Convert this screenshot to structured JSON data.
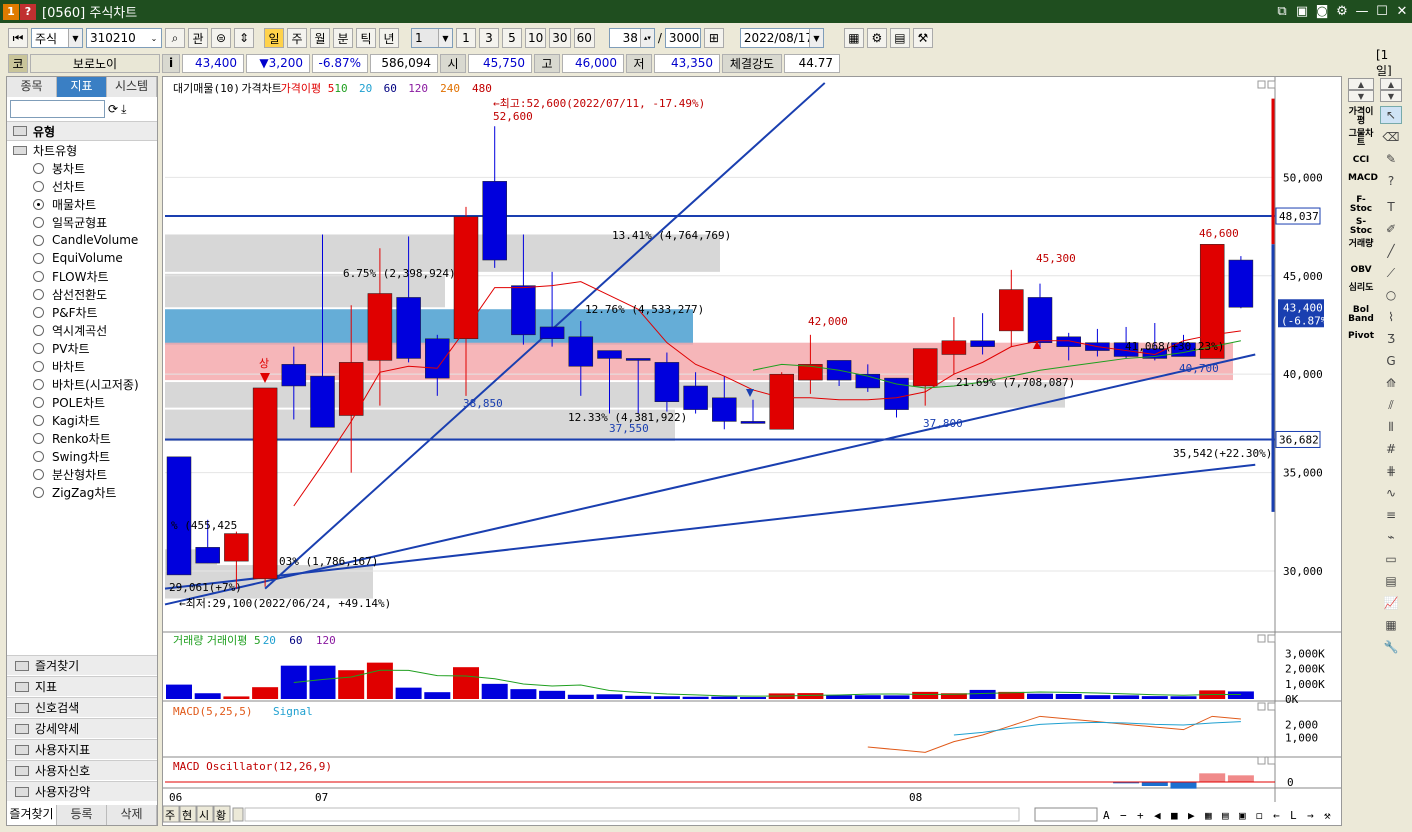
{
  "window": {
    "app_icon_1": "1",
    "app_icon_2": "?",
    "title": "[0560] 주식차트"
  },
  "toolbar": {
    "market": "주식",
    "code": "310210",
    "gwan": "관",
    "period_buttons": [
      "일",
      "주",
      "월",
      "분",
      "틱",
      "년"
    ],
    "active_period": "일",
    "interval_value": "1",
    "quick_counts": [
      "1",
      "3",
      "5",
      "10",
      "30",
      "60"
    ],
    "count_value": "38",
    "slash": "/",
    "total_count": "3000",
    "date_value": "2022/08/17"
  },
  "quote": {
    "code_badge": "코",
    "name": "보로노이",
    "info_btn": "i",
    "price": "43,400",
    "change": "▼3,200",
    "change_pct": "-6.87%",
    "volume": "586,094",
    "open_label": "시",
    "open": "45,750",
    "high_label": "고",
    "high": "46,000",
    "low_label": "저",
    "low": "43,350",
    "strength_label": "체결강도",
    "strength": "44.77",
    "period_badge": "[1일]"
  },
  "left_panel": {
    "tabs": [
      "종목",
      "지표",
      "시스템"
    ],
    "active_tab": "지표",
    "section_title": "유형",
    "subsection": "차트유형",
    "chart_types": [
      "봉차트",
      "선차트",
      "매물차트",
      "일목균형표",
      "CandleVolume",
      "EquiVolume",
      "FLOW차트",
      "삼선전환도",
      "P&F차트",
      "역시계곡선",
      "PV차트",
      "바차트",
      "바차트(시고저종)",
      "POLE차트",
      "Kagi차트",
      "Renko차트",
      "Swing차트",
      "분산형차트",
      "ZigZag차트"
    ],
    "selected_type": "매물차트",
    "folders": [
      "즐겨찾기",
      "지표",
      "신호검색",
      "강세약세",
      "사용자지표",
      "사용자신호",
      "사용자강약"
    ],
    "bottom_tabs": [
      "즐겨찾기",
      "등록",
      "삭제"
    ]
  },
  "chart": {
    "main_legend": [
      "대기매물(10)",
      "가격차트",
      "가격이평 5",
      "10",
      "20",
      "60",
      "120",
      "240",
      "480"
    ],
    "volume_legend": [
      "거래량",
      "거래이평 5",
      "20",
      "60",
      "120"
    ],
    "macd_legend": [
      "MACD(5,25,5)",
      "Signal"
    ],
    "osc_legend": [
      "MACD Oscillator(12,26,9)"
    ],
    "bottom_tabs": [
      "주",
      "현",
      "시",
      "황"
    ],
    "x_labels": [
      "06",
      "07",
      "08"
    ],
    "annotations": {
      "high_note": "←최고:52,600(2022/07/11, -17.49%)",
      "low_note": "←최저:29,100(2022/06/24, +49.14%)",
      "hi_52600": "52,600",
      "lo_38850": "38,850",
      "lo_37550": "37,550",
      "v_42000": "42,000",
      "lo_37800": "37,800",
      "v_45300": "45,300",
      "v_46600": "46,600",
      "lo_40700": "40,700",
      "sang": "상",
      "pct_a": "13.41% (4,764,769)",
      "pct_b": "6.75% (2,398,924)",
      "pct_c": "12.76% (4,533,277)",
      "pct_d": "12.33% (4,381,922)",
      "pct_e": "21.69% (7,708,087)",
      "pct_f": "% (455,425",
      "pct_g": "03% (1,786,167)",
      "fib_1": "35,542(+22.30%)",
      "fib_2": "41,068(+30.23%)",
      "fib_3": "29,061(+7%)"
    },
    "price_axis": [
      "50,000",
      "45,000",
      "40,000",
      "35,000",
      "30,000"
    ],
    "price_tags": [
      "48,037",
      "36,682"
    ],
    "current_tag": [
      "43,400",
      "(-6.87%)"
    ],
    "volume_axis": [
      "3,000K",
      "2,000K",
      "1,000K",
      "0K"
    ],
    "macd_axis": [
      "2,000",
      "1,000"
    ],
    "osc_axis": [
      "0"
    ],
    "colors": {
      "up": "#e00000",
      "down": "#0000dd",
      "band_red": "#f4a9ad",
      "band_blue": "#4a9fd0",
      "band_gray": "#d0d0d0",
      "trend": "#1a3fb0"
    }
  },
  "right_tools": {
    "labels": [
      "가격이평",
      "그물차트",
      "CCI",
      "MACD",
      "F-Stoc",
      "S-Stoc",
      "거래량",
      "OBV",
      "심리도",
      "Bol Band",
      "Pivot"
    ]
  },
  "chart_data": {
    "type": "candlestick",
    "y_range": [
      27000,
      55000
    ],
    "candles": [
      {
        "o": 35800,
        "h": 35800,
        "l": 29800,
        "c": 29800
      },
      {
        "o": 31200,
        "h": 32600,
        "l": 30400,
        "c": 30400
      },
      {
        "o": 30500,
        "h": 32000,
        "l": 29100,
        "c": 31900
      },
      {
        "o": 29600,
        "h": 39300,
        "l": 29200,
        "c": 39300
      },
      {
        "o": 40500,
        "h": 41400,
        "l": 37700,
        "c": 39400
      },
      {
        "o": 39900,
        "h": 47100,
        "l": 37300,
        "c": 37300
      },
      {
        "o": 37900,
        "h": 43500,
        "l": 35000,
        "c": 40600
      },
      {
        "o": 40700,
        "h": 46400,
        "l": 38400,
        "c": 44100
      },
      {
        "o": 43900,
        "h": 47000,
        "l": 40600,
        "c": 40800
      },
      {
        "o": 41800,
        "h": 42000,
        "l": 38900,
        "c": 39800
      },
      {
        "o": 41800,
        "h": 48500,
        "l": 38900,
        "c": 48000
      },
      {
        "o": 49800,
        "h": 52600,
        "l": 45400,
        "c": 45800
      },
      {
        "o": 44500,
        "h": 47100,
        "l": 41500,
        "c": 42000
      },
      {
        "o": 42400,
        "h": 45200,
        "l": 41400,
        "c": 41800
      },
      {
        "o": 41900,
        "h": 42700,
        "l": 38900,
        "c": 40400
      },
      {
        "o": 41200,
        "h": 41200,
        "l": 38000,
        "c": 40800
      },
      {
        "o": 40800,
        "h": 40800,
        "l": 38000,
        "c": 40700
      },
      {
        "o": 40600,
        "h": 41100,
        "l": 38100,
        "c": 38600
      },
      {
        "o": 39400,
        "h": 40100,
        "l": 38000,
        "c": 38200
      },
      {
        "o": 38800,
        "h": 39900,
        "l": 37200,
        "c": 37600
      },
      {
        "o": 37600,
        "h": 38700,
        "l": 37500,
        "c": 37500
      },
      {
        "o": 37200,
        "h": 40100,
        "l": 37200,
        "c": 40000
      },
      {
        "o": 39700,
        "h": 42000,
        "l": 39000,
        "c": 40500
      },
      {
        "o": 40700,
        "h": 40700,
        "l": 39400,
        "c": 39700
      },
      {
        "o": 40000,
        "h": 40500,
        "l": 39100,
        "c": 39300
      },
      {
        "o": 39800,
        "h": 39800,
        "l": 37800,
        "c": 38200
      },
      {
        "o": 39400,
        "h": 41300,
        "l": 38400,
        "c": 41300
      },
      {
        "o": 41000,
        "h": 42900,
        "l": 40000,
        "c": 41700
      },
      {
        "o": 41700,
        "h": 43100,
        "l": 41000,
        "c": 41400
      },
      {
        "o": 42200,
        "h": 45300,
        "l": 41400,
        "c": 44300
      },
      {
        "o": 43900,
        "h": 44600,
        "l": 41300,
        "c": 41600
      },
      {
        "o": 41900,
        "h": 42100,
        "l": 40700,
        "c": 41400
      },
      {
        "o": 41600,
        "h": 42300,
        "l": 40900,
        "c": 41200
      },
      {
        "o": 41600,
        "h": 42400,
        "l": 40800,
        "c": 40900
      },
      {
        "o": 41300,
        "h": 42600,
        "l": 40700,
        "c": 40800
      },
      {
        "o": 41600,
        "h": 42000,
        "l": 40900,
        "c": 40900
      },
      {
        "o": 40800,
        "h": 46600,
        "l": 40800,
        "c": 46600
      },
      {
        "o": 45800,
        "h": 46000,
        "l": 43350,
        "c": 43400
      }
    ],
    "ma5": [
      null,
      null,
      null,
      null,
      33300,
      35400,
      37600,
      40100,
      40400,
      40300,
      42300,
      44400,
      44400,
      44500,
      44700,
      44000,
      43300,
      41600,
      40500,
      39900,
      39200,
      38800,
      38800,
      38700,
      38700,
      38800,
      39100,
      40000,
      40600,
      41400,
      41700,
      41700,
      41400,
      41200,
      41000,
      41700,
      42000,
      42200
    ],
    "ma20": [
      null,
      null,
      null,
      null,
      null,
      null,
      null,
      null,
      null,
      null,
      null,
      null,
      null,
      null,
      null,
      null,
      null,
      null,
      null,
      null,
      40200,
      40500,
      40400,
      40200,
      39900,
      39500,
      39300,
      39400,
      39600,
      39900,
      40200,
      40400,
      40600,
      40800,
      40900,
      41100,
      41400,
      41700
    ],
    "volume_k": [
      950,
      380,
      170,
      780,
      2200,
      2200,
      1900,
      2400,
      750,
      450,
      2100,
      1000,
      650,
      540,
      280,
      310,
      210,
      180,
      150,
      160,
      130,
      370,
      390,
      250,
      250,
      240,
      470,
      380,
      600,
      470,
      350,
      330,
      250,
      240,
      190,
      180,
      570,
      500
    ],
    "volume_ma5": [
      null,
      null,
      null,
      null,
      1090,
      1290,
      1450,
      1900,
      1890,
      1540,
      1520,
      1340,
      990,
      860,
      920,
      560,
      440,
      330,
      270,
      210,
      190,
      200,
      240,
      260,
      320,
      330,
      300,
      310,
      360,
      410,
      460,
      440,
      400,
      340,
      280,
      250,
      300,
      300
    ],
    "macd": [
      null,
      null,
      null,
      null,
      null,
      null,
      null,
      null,
      null,
      null,
      null,
      null,
      null,
      null,
      null,
      null,
      null,
      null,
      null,
      null,
      null,
      null,
      null,
      null,
      300,
      100,
      -100,
      700,
      1200,
      1900,
      2600,
      2400,
      2200,
      2000,
      1800,
      1600,
      2600,
      2400
    ],
    "macd_signal": [
      null,
      null,
      null,
      null,
      null,
      null,
      null,
      null,
      null,
      null,
      null,
      null,
      null,
      null,
      null,
      null,
      null,
      null,
      null,
      null,
      null,
      null,
      null,
      null,
      null,
      null,
      null,
      1200,
      1400,
      1700,
      2000,
      2100,
      2150,
      2100,
      2000,
      1950,
      2100,
      2200
    ],
    "oscillator": [
      0,
      0,
      0,
      0,
      0,
      0,
      0,
      0,
      0,
      0,
      0,
      0,
      0,
      0,
      0,
      0,
      0,
      0,
      0,
      0,
      0,
      0,
      0,
      0,
      0,
      0,
      0,
      0,
      0,
      0,
      0,
      0,
      0,
      -40,
      -120,
      -200,
      260,
      200
    ]
  }
}
